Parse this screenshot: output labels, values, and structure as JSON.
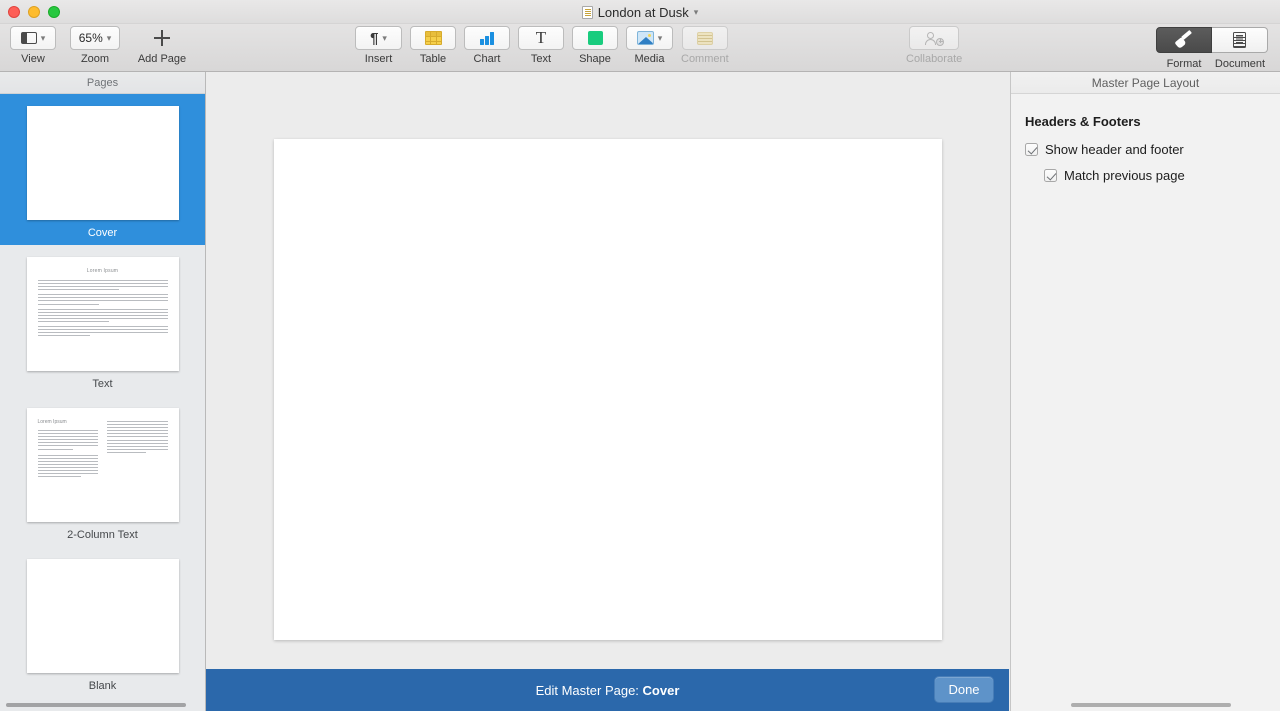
{
  "window": {
    "title": "London at Dusk",
    "title_icon": "document-icon",
    "title_chevron": "chevron-down-icon",
    "traffic_lights": [
      "close-button",
      "minimize-button",
      "zoom-button"
    ]
  },
  "toolbar": {
    "view": {
      "label": "View",
      "icon": "view-panel-icon",
      "chevron": "chevron-down-icon"
    },
    "zoom": {
      "label": "Zoom",
      "value": "65%",
      "chevron": "chevron-down-icon"
    },
    "add_page": {
      "label": "Add Page",
      "icon": "plus-icon"
    },
    "insert": {
      "label": "Insert",
      "icon": "pilcrow-icon",
      "chevron": "chevron-down-icon"
    },
    "table": {
      "label": "Table",
      "icon": "table-icon"
    },
    "chart": {
      "label": "Chart",
      "icon": "bar-chart-icon"
    },
    "text": {
      "label": "Text",
      "icon": "text-t-icon"
    },
    "shape": {
      "label": "Shape",
      "icon": "shape-square-icon"
    },
    "media": {
      "label": "Media",
      "icon": "photo-icon",
      "chevron": "chevron-down-icon"
    },
    "comment": {
      "label": "Comment",
      "icon": "sticky-note-icon",
      "disabled": true
    },
    "collaborate": {
      "label": "Collaborate",
      "icon": "add-person-icon",
      "disabled": true
    },
    "format": {
      "label": "Format",
      "icon": "paintbrush-icon",
      "active": true
    },
    "document": {
      "label": "Document",
      "icon": "document-lines-icon",
      "active": false
    }
  },
  "sidebar": {
    "header": "Pages",
    "pages": [
      {
        "name": "Cover",
        "selected": true,
        "layout": "blank"
      },
      {
        "name": "Text",
        "selected": false,
        "layout": "text",
        "thumb_title": "Lorem Ipsum"
      },
      {
        "name": "2-Column Text",
        "selected": false,
        "layout": "two-column",
        "thumb_title": "Lorem Ipsum"
      },
      {
        "name": "Blank",
        "selected": false,
        "layout": "blank"
      }
    ]
  },
  "inspector": {
    "header": "Master Page Layout",
    "section_title": "Headers & Footers",
    "options": [
      {
        "label": "Show header and footer",
        "checked": true,
        "indent": false
      },
      {
        "label": "Match previous page",
        "checked": true,
        "indent": true
      }
    ]
  },
  "banner": {
    "prefix": "Edit Master Page: ",
    "page_name": "Cover",
    "done_label": "Done",
    "background_color": "#2b68ab",
    "button_color": "#5e93c9"
  },
  "colors": {
    "selection_blue": "#2f8fdc",
    "banner_blue": "#2b68ab",
    "toolbar_gray": "#dedede",
    "canvas_gray": "#ececec"
  }
}
